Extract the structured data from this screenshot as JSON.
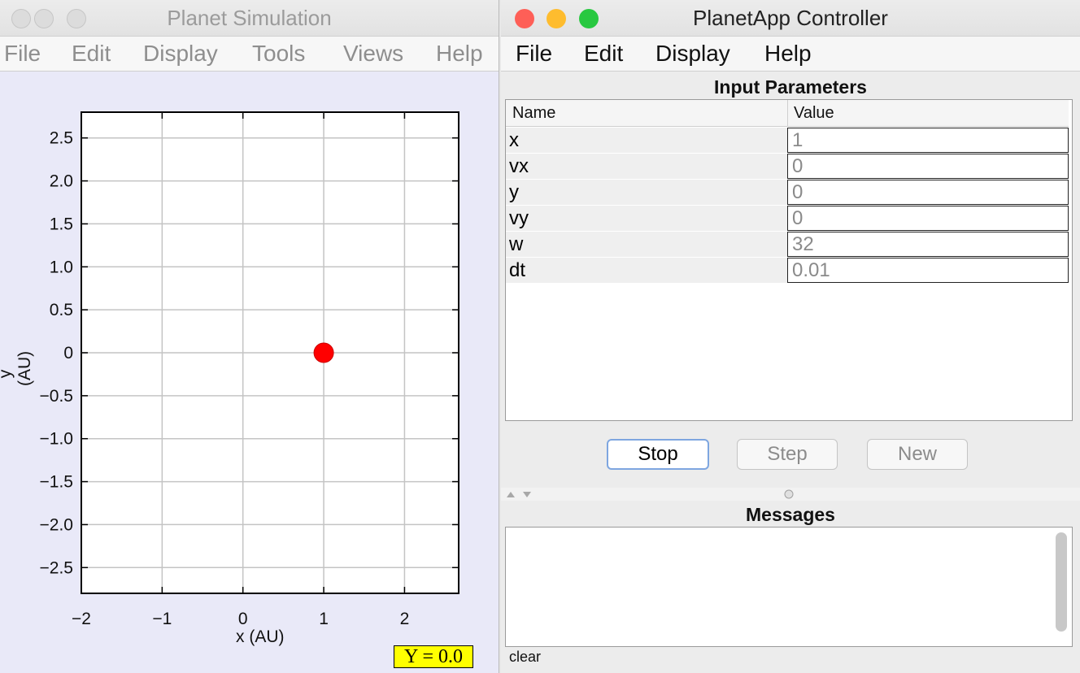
{
  "sim_window": {
    "title": "Planet Simulation",
    "menu": [
      "File",
      "Edit",
      "Display",
      "Tools",
      "Views",
      "Help"
    ],
    "readout": "Y = 0.0"
  },
  "chart_data": {
    "type": "scatter",
    "xlabel": "x (AU)",
    "ylabel": "y (AU)",
    "xlim": [
      -2,
      2.67
    ],
    "ylim": [
      -2.8,
      2.8
    ],
    "x_ticks": [
      -2,
      -1,
      0,
      1,
      2
    ],
    "x_tick_labels": [
      "−2",
      "−1",
      "0",
      "1",
      "2"
    ],
    "y_ticks": [
      2.5,
      2.0,
      1.5,
      1.0,
      0.5,
      0,
      -0.5,
      -1.0,
      -1.5,
      -2.0,
      -2.5
    ],
    "y_tick_labels": [
      "2.5",
      "2.0",
      "1.5",
      "1.0",
      "0.5",
      "0",
      "−0.5",
      "−1.0",
      "−1.5",
      "−2.0",
      "−2.5"
    ],
    "grid": true,
    "points": [
      {
        "x": 1,
        "y": 0
      }
    ],
    "colors": {
      "point": "#ff0000",
      "grid": "#c4c4c4"
    }
  },
  "controller": {
    "title": "PlanetApp Controller",
    "menu": [
      "File",
      "Edit",
      "Display",
      "Help"
    ],
    "input_title": "Input Parameters",
    "columns": [
      "Name",
      "Value"
    ],
    "params": [
      {
        "name": "x",
        "value": "1"
      },
      {
        "name": "vx",
        "value": "0"
      },
      {
        "name": "y",
        "value": "0"
      },
      {
        "name": "vy",
        "value": "0"
      },
      {
        "name": "w",
        "value": "32"
      },
      {
        "name": "dt",
        "value": "0.01"
      }
    ],
    "buttons": {
      "stop": "Stop",
      "step": "Step",
      "new": "New"
    },
    "messages_title": "Messages",
    "clear_label": "clear"
  },
  "traffic_lights": {
    "close": "#fe5f57",
    "minimize": "#febc2e",
    "zoom": "#28c840"
  }
}
